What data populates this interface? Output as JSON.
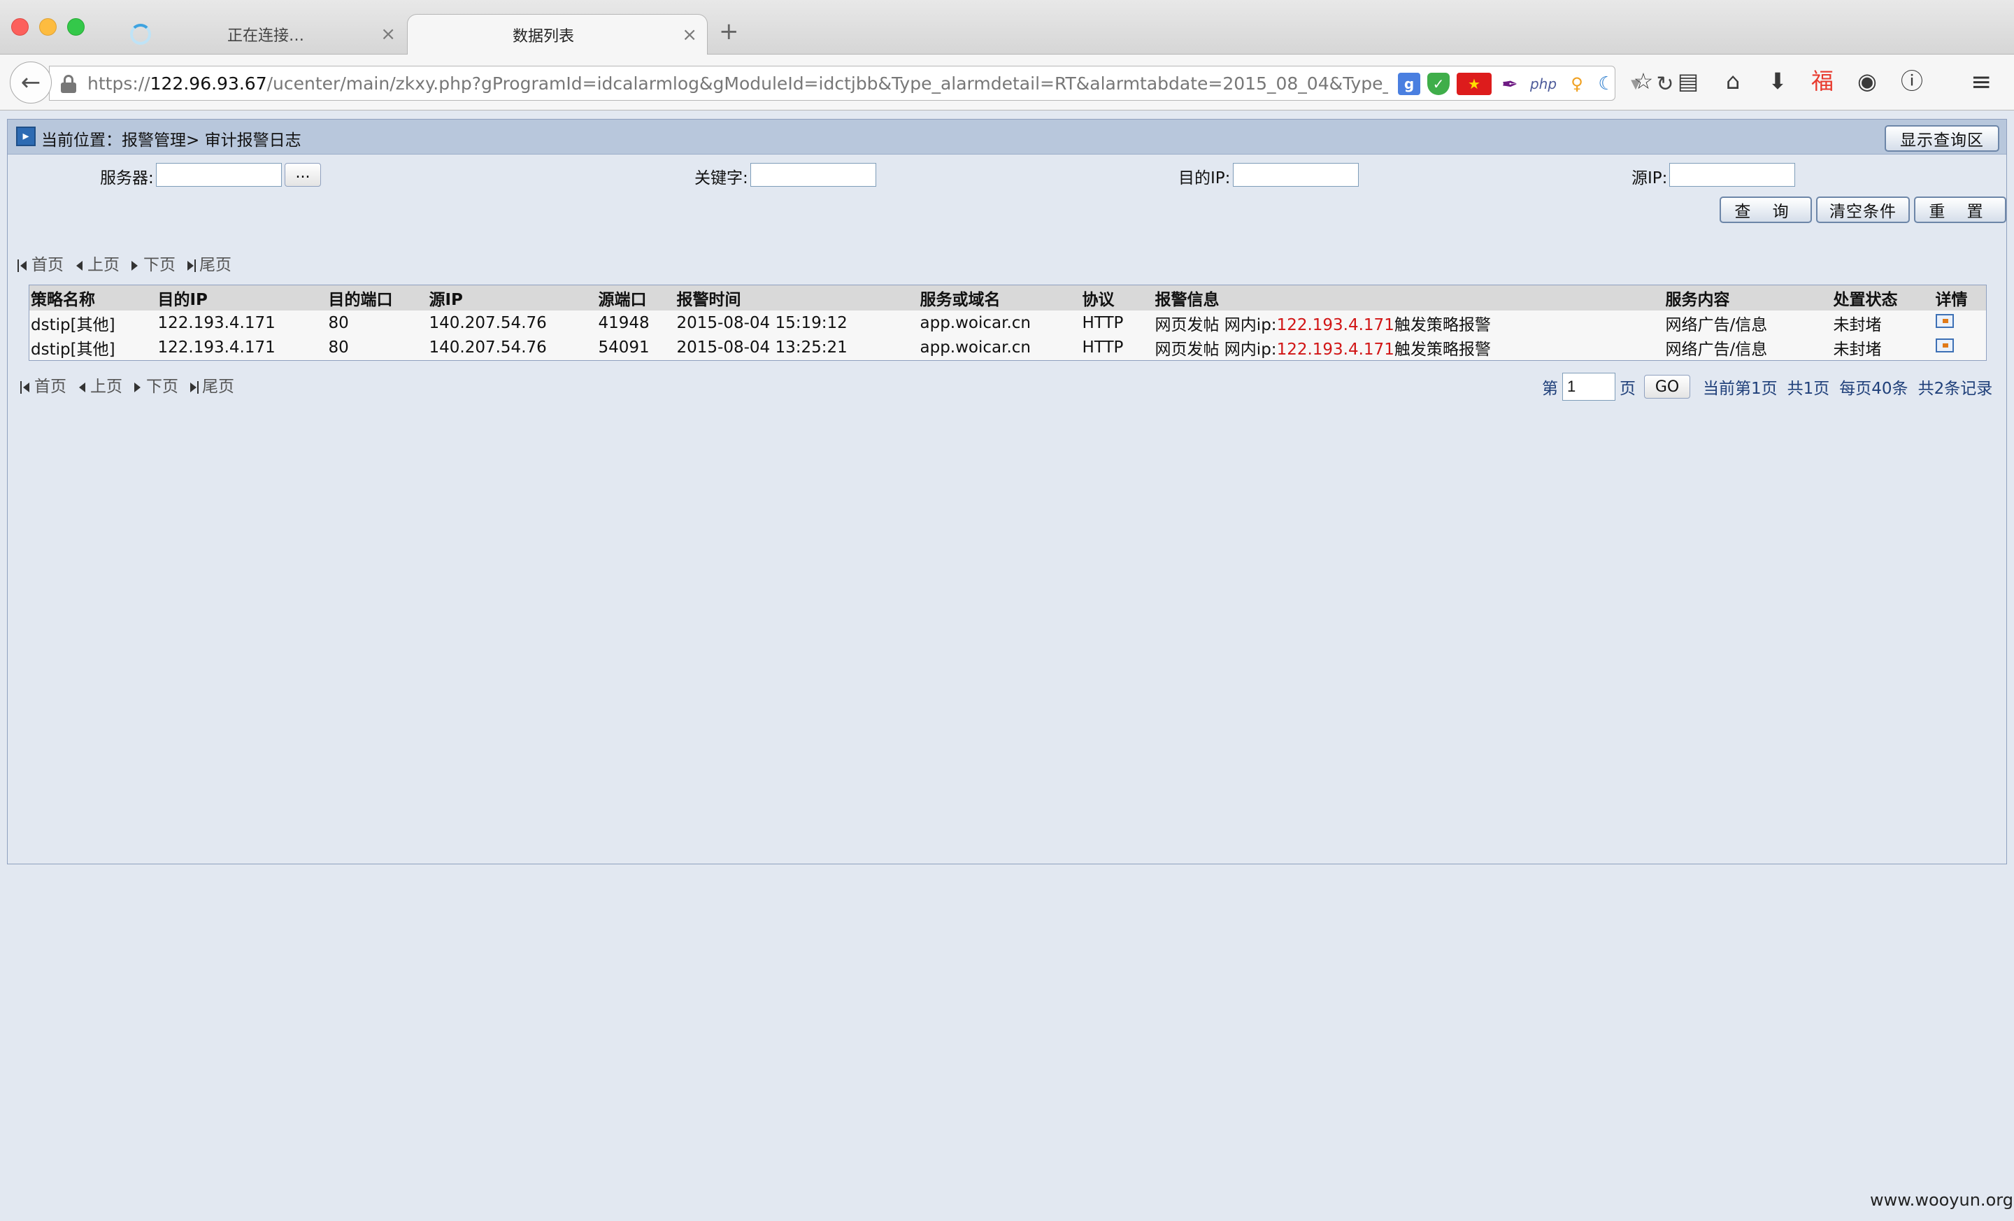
{
  "browser": {
    "tabs": [
      {
        "title": "正在连接…",
        "close": "×",
        "loading": true
      },
      {
        "title": "数据列表",
        "close": "×",
        "active": true
      }
    ],
    "new_tab": "+",
    "url": {
      "scheme": "https://",
      "host": "122.96.93.67",
      "path": "/ucenter/main/zkxy.php?gProgramId=idcalarmlog&gModuleId=idctjbb&Type_alarmdetail=RT&alarmtabdate=2015_08_04&Type_alarmdelconditon"
    },
    "extensions": {
      "google": "g",
      "shield": "✓",
      "flag": "★",
      "feather": "✒",
      "php": "php",
      "bulb": "♀",
      "swirl": "☾",
      "dropdown": "▼",
      "reload": "↻"
    },
    "toolbar": {
      "bookmark": "☆",
      "reading": "▤",
      "home": "⌂",
      "download": "⬇",
      "addon": "福",
      "globe": "◉",
      "info": "ⓘ",
      "menu": "≡"
    }
  },
  "page": {
    "breadcrumb": {
      "prefix": "当前位置：",
      "section": "报警管理>",
      "current": "审计报警日志"
    },
    "toggle_query_label": "显示查询区",
    "filters": {
      "server_label": "服务器:",
      "server_value": "",
      "server_picker_label": "...",
      "keyword_label": "关键字:",
      "keyword_value": "",
      "dest_ip_label": "目的IP:",
      "dest_ip_value": "",
      "src_ip_label": "源IP:",
      "src_ip_value": ""
    },
    "actions": {
      "query": "查 询",
      "clear": "清空条件",
      "reset": "重 置"
    },
    "pager": {
      "first": "首页",
      "prev": "上页",
      "next": "下页",
      "last": "尾页"
    },
    "table": {
      "columns": [
        "策略名称",
        "目的IP",
        "目的端口",
        "源IP",
        "源端口",
        "报警时间",
        "服务或域名",
        "协议",
        "报警信息",
        "服务内容",
        "处置状态",
        "详情"
      ],
      "rows": [
        {
          "policy": "dstip[其他]",
          "dest_ip": "122.193.4.171",
          "dest_port": "80",
          "src_ip": "140.207.54.76",
          "src_port": "41948",
          "time": "2015-08-04 15:19:12",
          "domain": "app.woicar.cn",
          "protocol": "HTTP",
          "msg_prefix": "网页发帖 网内ip:",
          "msg_ip": "122.193.4.171",
          "msg_suffix": "触发策略报警",
          "content": "网络广告/信息",
          "status": "未封堵"
        },
        {
          "policy": "dstip[其他]",
          "dest_ip": "122.193.4.171",
          "dest_port": "80",
          "src_ip": "140.207.54.76",
          "src_port": "54091",
          "time": "2015-08-04 13:25:21",
          "domain": "app.woicar.cn",
          "protocol": "HTTP",
          "msg_prefix": "网页发帖 网内ip:",
          "msg_ip": "122.193.4.171",
          "msg_suffix": "触发策略报警",
          "content": "网络广告/信息",
          "status": "未封堵"
        }
      ]
    },
    "page_info": {
      "page_prefix": "第",
      "page_value": "1",
      "page_suffix": "页",
      "go": "GO",
      "current": "当前第1页",
      "total_pages": "共1页",
      "per_page": "每页40条",
      "total_records": "共2条记录"
    }
  },
  "watermark": "www.wooyun.org"
}
